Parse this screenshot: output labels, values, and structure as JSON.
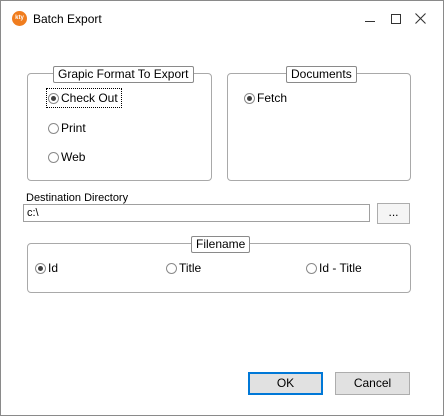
{
  "window": {
    "title": "Batch Export",
    "app_icon_text": "kty"
  },
  "graphic_format": {
    "legend": "Grapic Format To Export",
    "options": [
      {
        "label": "Check Out",
        "selected": true
      },
      {
        "label": "Print",
        "selected": false
      },
      {
        "label": "Web",
        "selected": false
      }
    ]
  },
  "documents": {
    "legend": "Documents",
    "options": [
      {
        "label": "Fetch",
        "selected": true
      }
    ]
  },
  "destination": {
    "label": "Destination Directory",
    "value": "c:\\",
    "browse_label": "..."
  },
  "filename": {
    "legend": "Filename",
    "options": [
      {
        "label": "Id",
        "selected": true
      },
      {
        "label": "Title",
        "selected": false
      },
      {
        "label": "Id - Title",
        "selected": false
      }
    ]
  },
  "buttons": {
    "ok": "OK",
    "cancel": "Cancel"
  }
}
